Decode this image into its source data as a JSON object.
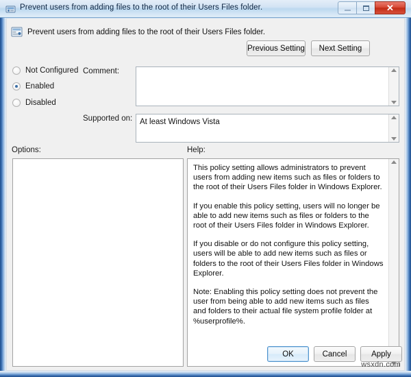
{
  "window": {
    "title": "Prevent users from adding files to the root of their Users Files folder.",
    "icon": "group-policy-icon",
    "controls": {
      "minimize": "Minimize",
      "maximize": "Restore",
      "close": "Close",
      "close_glyph": "✕"
    }
  },
  "header": {
    "icon": "policy-setting-icon",
    "title": "Prevent users from adding files to the root of their Users Files folder.",
    "previous_setting_label": "Previous Setting",
    "next_setting_label": "Next Setting"
  },
  "state": {
    "options": [
      {
        "id": "not-configured",
        "label": "Not Configured",
        "selected": false
      },
      {
        "id": "enabled",
        "label": "Enabled",
        "selected": true
      },
      {
        "id": "disabled",
        "label": "Disabled",
        "selected": false
      }
    ],
    "selected": "Enabled"
  },
  "comment": {
    "label": "Comment:",
    "value": "",
    "placeholder": ""
  },
  "supported_on": {
    "label": "Supported on:",
    "value": "At least Windows Vista"
  },
  "panels": {
    "options_label": "Options:",
    "options_content": "",
    "help_label": "Help:",
    "help_paragraphs": [
      "This policy setting allows administrators to prevent users from adding new items such as files or folders to the root of their Users Files folder in Windows Explorer.",
      "If you enable this policy setting, users will no longer be able to add new items such as files or folders to the root of their Users Files folder in Windows Explorer.",
      "If you disable or do not configure this policy setting, users will be able to add new items such as files or folders to the root of their Users Files folder in Windows Explorer.",
      "Note: Enabling this policy setting does not prevent the user from being able to add new items such as files and folders to their actual file system profile folder at %userprofile%."
    ]
  },
  "footer": {
    "ok_label": "OK",
    "cancel_label": "Cancel",
    "apply_label": "Apply"
  },
  "watermark": {
    "text": "wsxdn.com"
  },
  "colors": {
    "accent": "#3a6ea5",
    "close_button": "#c22d16",
    "frame": "#21508f",
    "panel_background": "#f0f0f0"
  }
}
